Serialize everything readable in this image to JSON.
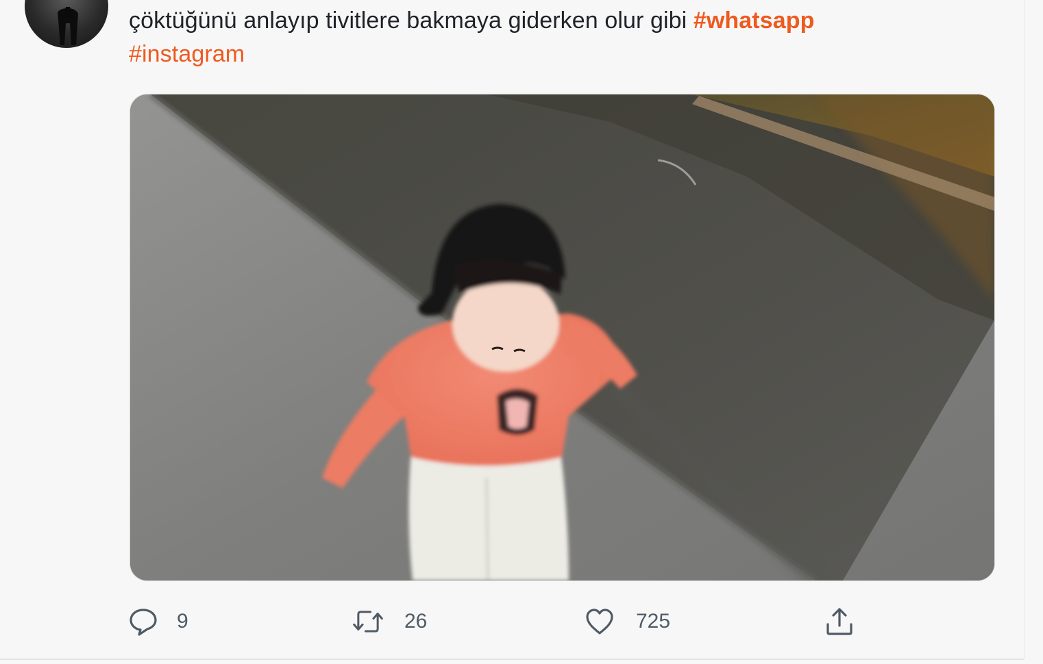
{
  "tweet": {
    "text_plain": "çöktüğünü anlayıp tivitlere bakmaya giderken olur gibi ",
    "hashtags": [
      "#whatsapp",
      "#instagram"
    ]
  },
  "actions": {
    "reply": {
      "count": "9",
      "icon": "speech-bubble-icon"
    },
    "retweet": {
      "count": "26",
      "icon": "retweet-arrows-icon"
    },
    "like": {
      "count": "725",
      "icon": "heart-icon"
    },
    "share": {
      "icon": "share-upload-icon"
    }
  },
  "colors": {
    "hashtag": "#ee5a1f",
    "text": "#1f2328",
    "action": "#4f5a64",
    "background": "#f7f7f7"
  }
}
